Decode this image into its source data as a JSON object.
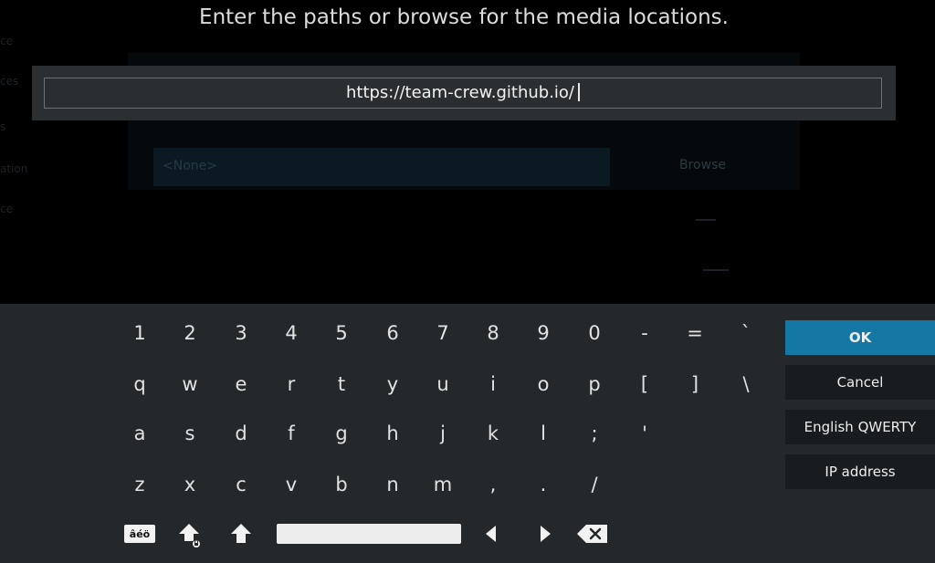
{
  "dialog": {
    "heading": "Enter the paths or browse for the media locations.",
    "input_value": "https://team-crew.github.io/"
  },
  "background": {
    "path_placeholder": "<None>",
    "browse_label": "Browse",
    "side_labels": [
      "ce",
      "ces",
      "s",
      "ation",
      "ce"
    ]
  },
  "keyboard": {
    "rows": [
      [
        "1",
        "2",
        "3",
        "4",
        "5",
        "6",
        "7",
        "8",
        "9",
        "0",
        "-",
        "=",
        "`"
      ],
      [
        "q",
        "w",
        "e",
        "r",
        "t",
        "y",
        "u",
        "i",
        "o",
        "p",
        "[",
        "]",
        "\\"
      ],
      [
        "a",
        "s",
        "d",
        "f",
        "g",
        "h",
        "j",
        "k",
        "l",
        ";",
        "'"
      ],
      [
        "z",
        "x",
        "c",
        "v",
        "b",
        "n",
        "m",
        ",",
        ".",
        "/"
      ]
    ],
    "accent_label": "âéö",
    "icons": {
      "caps_lock": "caps-lock-icon",
      "shift": "shift-icon",
      "left": "arrow-left-icon",
      "right": "arrow-right-icon",
      "backspace": "backspace-icon"
    }
  },
  "sidebar": {
    "ok": "OK",
    "cancel": "Cancel",
    "layout": "English QWERTY",
    "ip": "IP address"
  },
  "colors": {
    "accent": "#1577a3",
    "panel": "#25282a",
    "button": "#191c1e"
  }
}
